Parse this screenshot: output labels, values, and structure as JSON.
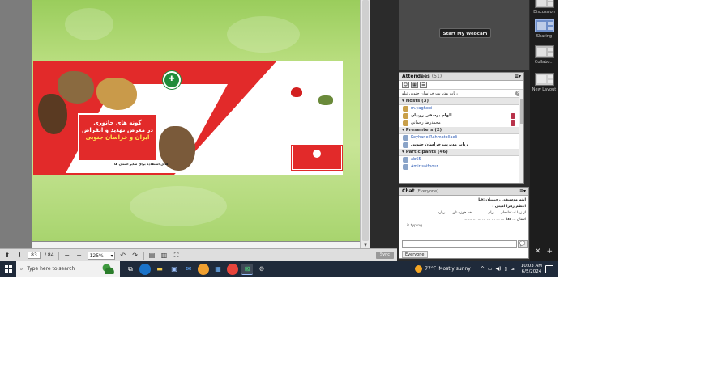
{
  "slide": {
    "title_line1": "گونه های جانوری",
    "title_line2": "در معرض تهدید و انقراض",
    "title_line3": "ایران و خراسان جنوبی",
    "footer": "قابل استفاده برای سایر استان ها"
  },
  "toolbar": {
    "page_current": "83",
    "page_total": "/ 84",
    "zoom": "125%",
    "sync_label": "Sync"
  },
  "webcam": {
    "start_label": "Start My Webcam"
  },
  "attendees": {
    "title": "Attendees",
    "count": "(51)",
    "status_text": "ربات مدیریت خراسان جنوبی تیلو",
    "groups": [
      {
        "label": "Hosts (3)",
        "rows": [
          "m.yaghobi",
          "الهام یوسفی روپیان",
          "محمدرضا رحمانی"
        ]
      },
      {
        "label": "Presenters (2)",
        "rows": [
          "Keyhane Rahmatollaeli",
          "ربات مدیریت خراسان جنوبی"
        ]
      },
      {
        "label": "Participants (46)",
        "rows": [
          "ab65",
          "Amir saifpour"
        ]
      }
    ]
  },
  "chat": {
    "title": "Chat",
    "scope": "(Everyone)",
    "messages": [
      "اینم موسیقی رحیمیان :Le",
      "اعظم زهرا امینی :",
      "از زیبا استفاده‌ای ... برای ... ... ... اخذ خوزستان ... درباره",
      "استان ... فعلا ... ... ... ... ... ... ... ... ...",
      "... is typing"
    ],
    "tab_label": "Everyone"
  },
  "layouts": {
    "items": [
      "Discussion",
      "Sharing",
      "Collabo...",
      "New Layout"
    ]
  },
  "taskbar": {
    "search_placeholder": "Type here to search",
    "temperature": "77°F",
    "weather": "Mostly sunny",
    "lang": "ما",
    "time": "10:03 AM",
    "date": "6/5/2024"
  },
  "colors": {
    "slide_red": "#e22a2a",
    "slide_green_bg": "#b8dd7e",
    "taskbar": "#1f2a3a",
    "accent_blue": "#6d8ec9"
  }
}
